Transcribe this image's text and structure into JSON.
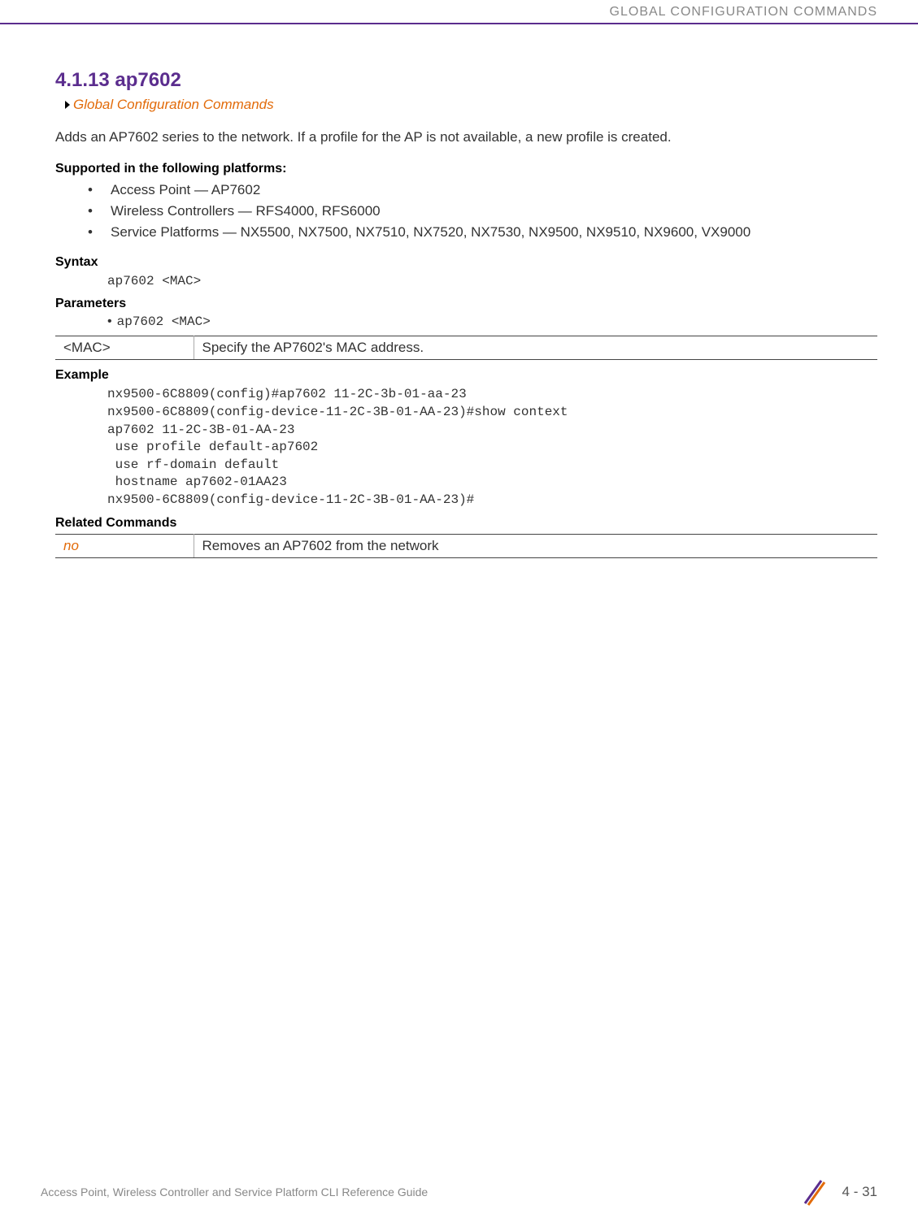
{
  "header": {
    "category": "GLOBAL CONFIGURATION COMMANDS"
  },
  "section": {
    "number_title": "4.1.13 ap7602",
    "breadcrumb": "Global Configuration Commands",
    "description": "Adds an AP7602 series to the network. If a profile for the AP is not available, a new profile is created."
  },
  "supported": {
    "heading": "Supported in the following platforms:",
    "items": [
      "Access Point — AP7602",
      "Wireless Controllers — RFS4000, RFS6000",
      "Service Platforms — NX5500, NX7500, NX7510, NX7520, NX7530, NX9500, NX9510, NX9600, VX9000"
    ]
  },
  "syntax": {
    "heading": "Syntax",
    "code": "ap7602 <MAC>"
  },
  "parameters": {
    "heading": "Parameters",
    "bullet": "ap7602 <MAC>",
    "table": {
      "cell1": "<MAC>",
      "cell2": "Specify the AP7602's MAC address."
    }
  },
  "example": {
    "heading": "Example",
    "code": "nx9500-6C8809(config)#ap7602 11-2C-3b-01-aa-23\nnx9500-6C8809(config-device-11-2C-3B-01-AA-23)#show context\nap7602 11-2C-3B-01-AA-23\n use profile default-ap7602\n use rf-domain default\n hostname ap7602-01AA23\nnx9500-6C8809(config-device-11-2C-3B-01-AA-23)#"
  },
  "related": {
    "heading": "Related Commands",
    "table": {
      "cell1": "no",
      "cell2": "Removes an AP7602 from the network"
    }
  },
  "footer": {
    "text": "Access Point, Wireless Controller and Service Platform CLI Reference Guide",
    "page": "4 - 31"
  }
}
